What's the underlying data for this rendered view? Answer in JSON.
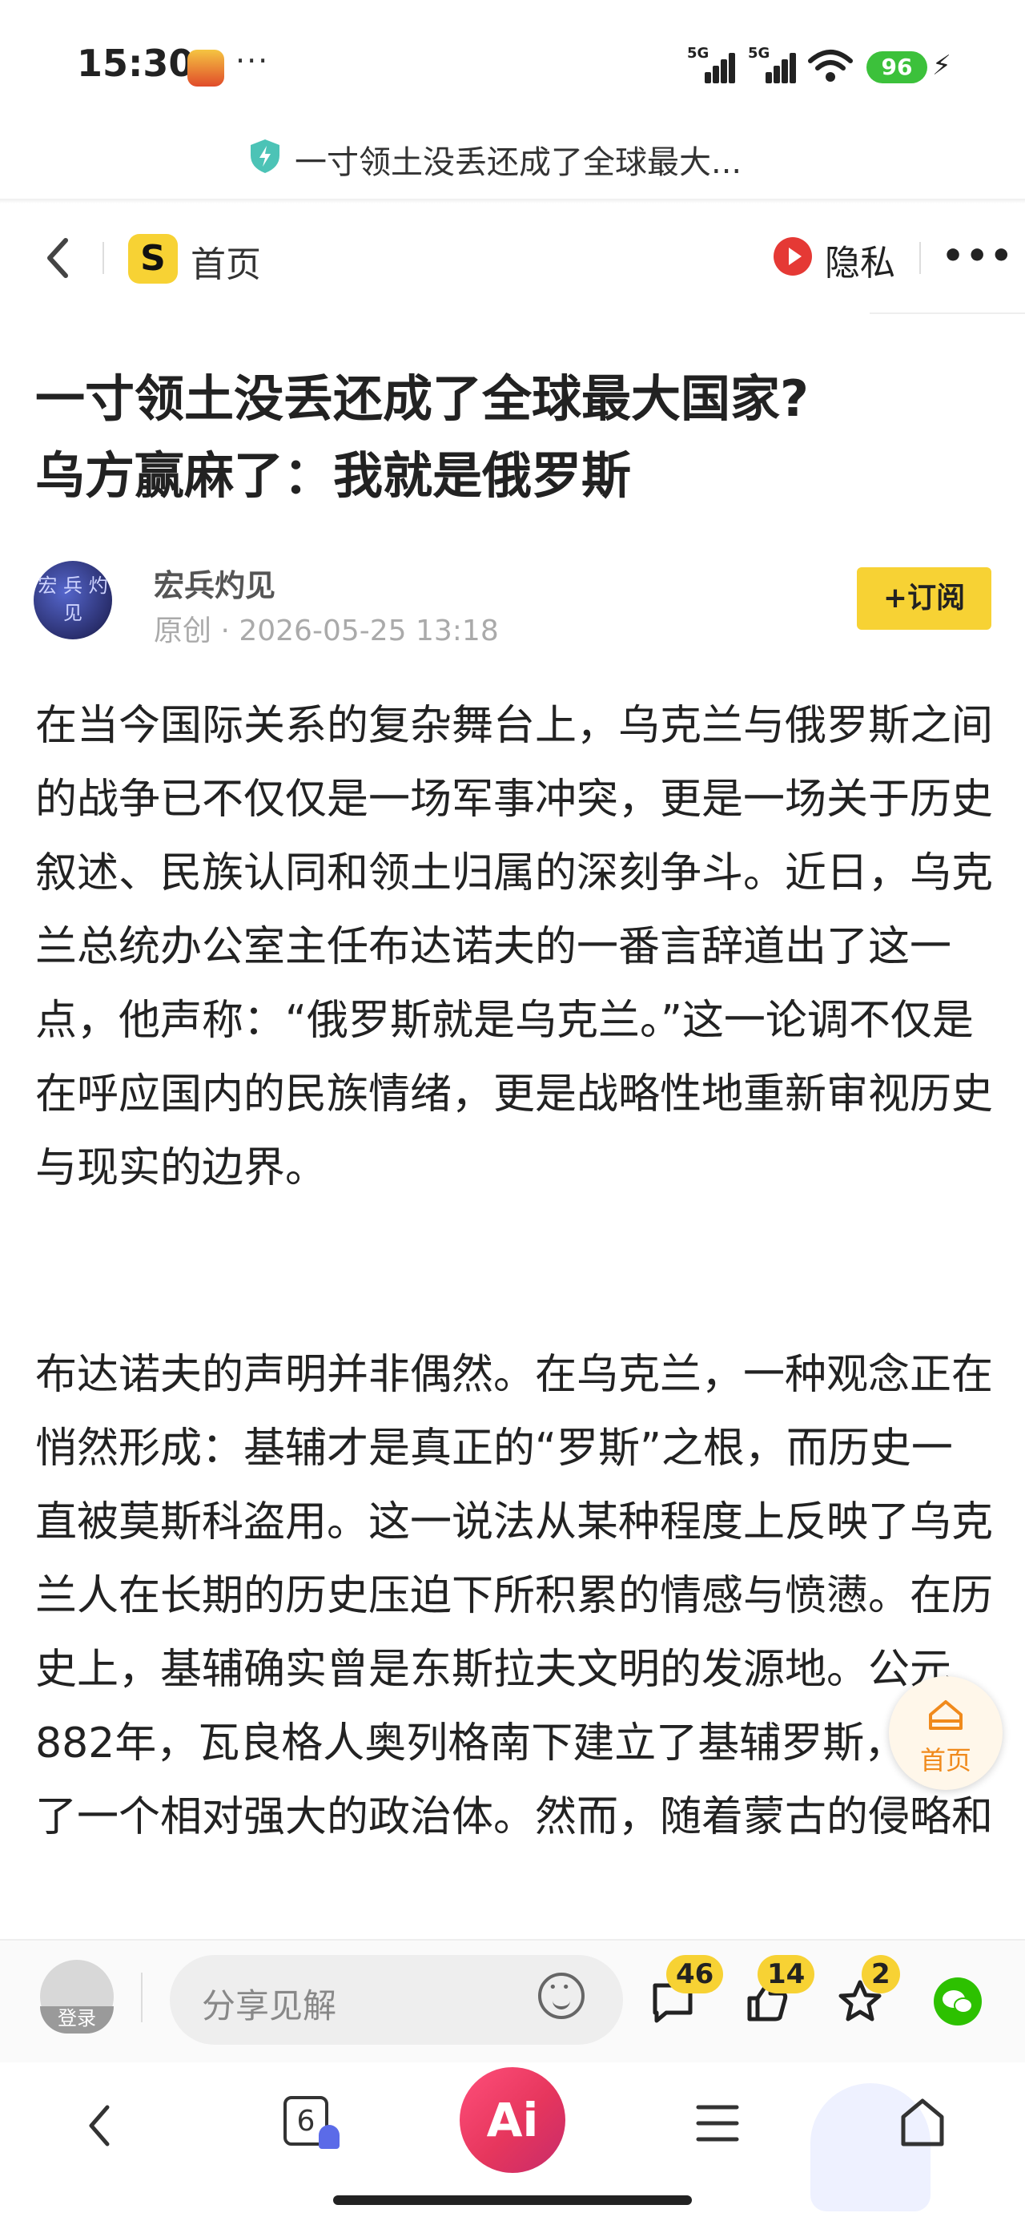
{
  "status_bar": {
    "time": "15:30",
    "dots": "···",
    "network1": "5G",
    "network2": "5G",
    "battery": "96"
  },
  "url_bar": {
    "title": "一寸领土没丢还成了全球最大..."
  },
  "nav": {
    "logo_letter": "S",
    "home_label": "首页",
    "privacy_label": "隐私",
    "more_label": "•••"
  },
  "article": {
    "title_line1": "一寸领土没丢还成了全球最大国家?",
    "title_line2": "乌方赢麻了：我就是俄罗斯",
    "avatar_text": "宏 兵 灼 见",
    "author": "宏兵灼见",
    "meta": "原创 · 2026-05-25 13:18",
    "subscribe_label": "+订阅",
    "paragraphs": [
      "在当今国际关系的复杂舞台上，乌克兰与俄罗斯之间的战争已不仅仅是一场军事冲突，更是一场关于历史叙述、民族认同和领土归属的深刻争斗。近日，乌克兰总统办公室主任布达诺夫的一番言辞道出了这一点，他声称：“俄罗斯就是乌克兰。”这一论调不仅是在呼应国内的民族情绪，更是战略性地重新审视历史与现实的边界。",
      "布达诺夫的声明并非偶然。在乌克兰，一种观念正在悄然形成：基辅才是真正的“罗斯”之根，而历史一直被莫斯科盗用。这一说法从某种程度上反映了乌克兰人在长期的历史压迫下所积累的情感与愤懑。在历史上，基辅确实曾是东斯拉夫文明的发源地。公元882年，瓦良格人奥列格南下建立了基辅罗斯，成为了一个相对强大的政治体。然而，随着蒙古的侵略和"
    ]
  },
  "float_button": {
    "label": "首页"
  },
  "toolbar": {
    "login_label": "登录",
    "comment_placeholder": "分享见解",
    "comment_count": "46",
    "like_count": "14",
    "favorite_count": "2"
  },
  "bottom_nav": {
    "tabs_count": "6",
    "ai_label": "Ai"
  },
  "colors": {
    "accent_yellow": "#f7d234",
    "privacy_red": "#e53935",
    "ai_pink": "#e6365d",
    "wechat_green": "#2dc100",
    "battery_green": "#3cc13b"
  }
}
